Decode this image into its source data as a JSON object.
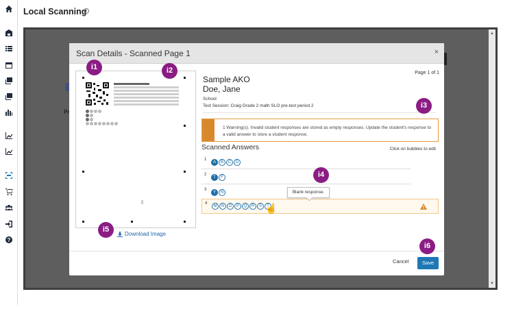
{
  "page": {
    "title": "Local Scanning",
    "info_icon": "i"
  },
  "nav_icons": [
    "home-icon",
    "school-icon",
    "list-icon",
    "calendar-icon",
    "inbox-icon",
    "export-icon",
    "chart-icon",
    "trend-icon",
    "trend2-icon",
    "scan-icon",
    "cart-icon",
    "users-icon",
    "login-icon",
    "help-icon"
  ],
  "background": {
    "fragment_text": "Pr"
  },
  "modal": {
    "title": "Scan Details - Scanned Page 1",
    "close": "×",
    "pager": "Page 1 of 1",
    "student_first": "Sample AKO",
    "student_last": "Doe, Jane",
    "school_label": "School",
    "test_session": "Test Session: Craig Grade 2 math SLO pre-test period 2",
    "warning": "1 Warning(s). Invalid student responses are stored as empty responses. Update the student's response to a valid answer to store a student response.",
    "answers_title": "Scanned Answers",
    "edit_hint": "Click on bubbles to edit",
    "download": "Download Image",
    "tooltip": "Blank response.",
    "cancel": "Cancel",
    "save": "Save"
  },
  "answers": [
    {
      "num": "1",
      "options": [
        "A",
        "B",
        "C",
        "D"
      ],
      "selected": "A"
    },
    {
      "num": "2",
      "options": [
        "T",
        "F"
      ],
      "selected": "T"
    },
    {
      "num": "3",
      "options": [
        "Y",
        "N"
      ],
      "selected": "Y"
    },
    {
      "num": "4",
      "options": [
        "M",
        "N",
        "O",
        "P",
        "Q",
        "R",
        "S",
        "T"
      ],
      "selected": "",
      "warning": true
    }
  ],
  "callouts": [
    "i1",
    "i2",
    "i3",
    "i4",
    "i5",
    "i6"
  ],
  "colors": {
    "callout": "#8a1c84",
    "accent": "#1f78b4",
    "warning": "#d8892d"
  }
}
